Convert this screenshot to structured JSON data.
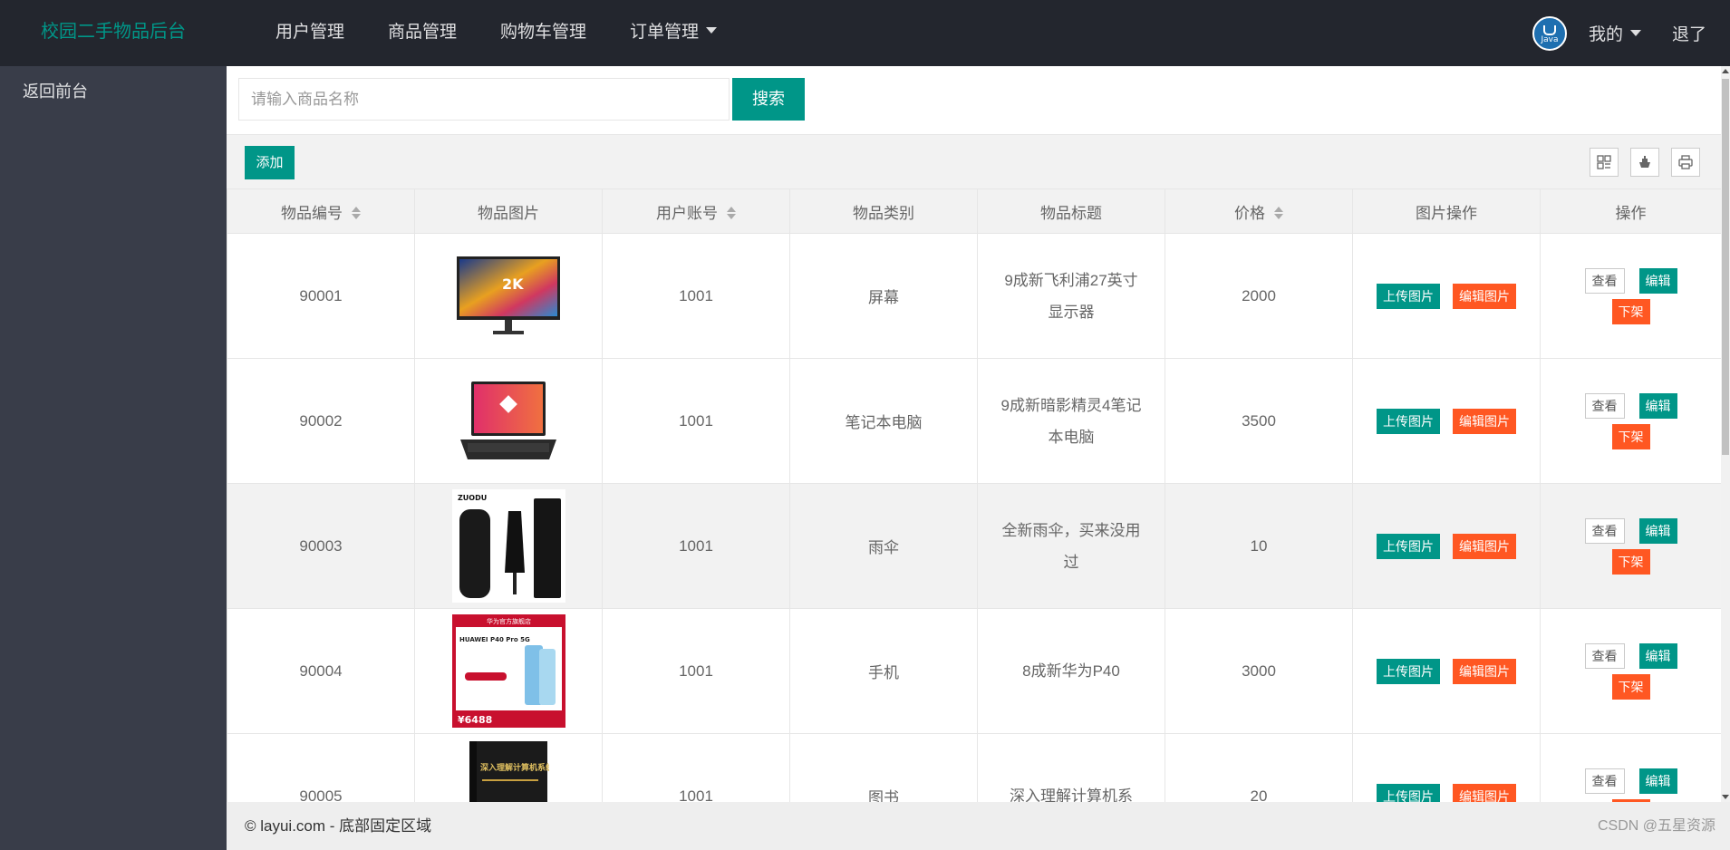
{
  "app": {
    "title": "校园二手物品后台"
  },
  "nav": {
    "items": [
      {
        "label": "用户管理"
      },
      {
        "label": "商品管理"
      },
      {
        "label": "购物车管理"
      },
      {
        "label": "订单管理"
      }
    ],
    "avatar_text": "Java",
    "mine_label": "我的",
    "logout_label": "退了"
  },
  "sidebar": {
    "items": [
      {
        "label": "返回前台"
      }
    ]
  },
  "search": {
    "placeholder": "请输入商品名称",
    "value": "",
    "button_label": "搜索"
  },
  "toolbar": {
    "add_label": "添加",
    "icons": [
      "columns-icon",
      "export-icon",
      "print-icon"
    ]
  },
  "table": {
    "columns": [
      {
        "label": "物品编号",
        "sortable": true
      },
      {
        "label": "物品图片",
        "sortable": false
      },
      {
        "label": "用户账号",
        "sortable": true
      },
      {
        "label": "物品类别",
        "sortable": false
      },
      {
        "label": "物品标题",
        "sortable": false
      },
      {
        "label": "价格",
        "sortable": true
      },
      {
        "label": "图片操作",
        "sortable": false
      },
      {
        "label": "操作",
        "sortable": false
      }
    ],
    "rows": [
      {
        "id": "90001",
        "image": "monitor-image",
        "account": "1001",
        "category": "屏幕",
        "title": "9成新飞利浦27英寸显示器",
        "price": "2000"
      },
      {
        "id": "90002",
        "image": "laptop-image",
        "account": "1001",
        "category": "笔记本电脑",
        "title": "9成新暗影精灵4笔记本电脑",
        "price": "3500"
      },
      {
        "id": "90003",
        "image": "umbrella-image",
        "account": "1001",
        "category": "雨伞",
        "title": "全新雨伞，买来没用过",
        "price": "10"
      },
      {
        "id": "90004",
        "image": "phone-image",
        "account": "1001",
        "category": "手机",
        "title": "8成新华为P40",
        "price": "3000"
      },
      {
        "id": "90005",
        "image": "book-image",
        "account": "1001",
        "category": "图书",
        "title": "深入理解计算机系",
        "price": "20"
      }
    ],
    "image_ops": {
      "upload_label": "上传图片",
      "edit_label": "编辑图片"
    },
    "row_ops": {
      "view_label": "查看",
      "edit_label": "编辑",
      "offshelf_label": "下架"
    },
    "highlight_row": 2
  },
  "thumb_text": {
    "monitor": "2K",
    "umbrella_brand": "ZUODU",
    "phone_banner": "华为官方旗舰店",
    "phone_model": "HUAWEI P40 Pro 5G",
    "phone_price": "¥6488",
    "book_title": "深入理解计算机系统"
  },
  "footer": {
    "text": "© layui.com - 底部固定区域",
    "watermark": "CSDN @五星资源"
  },
  "colors": {
    "accent": "#009688",
    "danger": "#ff5722",
    "header_bg": "#23262e",
    "side_bg": "#393d49"
  }
}
